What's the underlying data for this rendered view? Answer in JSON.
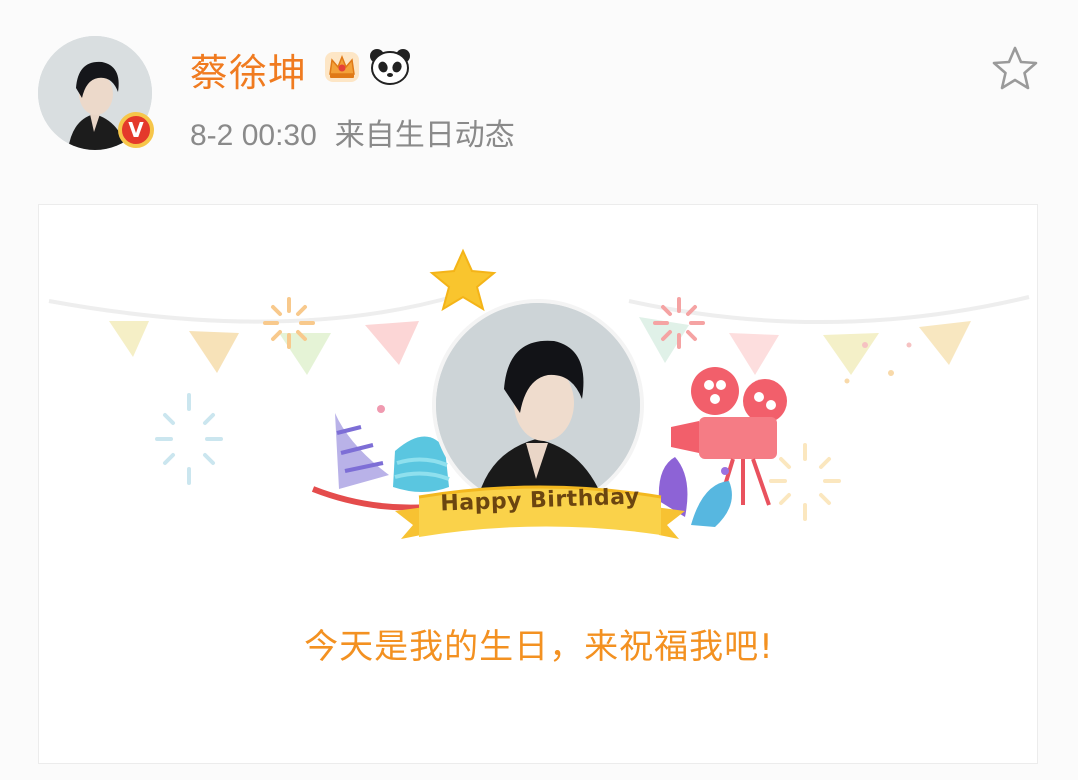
{
  "user": {
    "name": "蔡徐坤",
    "verified_mark": "V",
    "badges": [
      "crown-icon",
      "panda-icon"
    ]
  },
  "post": {
    "time": "8-2 00:30",
    "source": "来自生日动态"
  },
  "card": {
    "ribbon_text": "Happy Birthday",
    "message": "今天是我的生日，来祝福我吧!"
  },
  "colors": {
    "name": "#f07b20",
    "message": "#f39121",
    "meta": "#8a8a8a",
    "ribbon": "#f7c232"
  }
}
